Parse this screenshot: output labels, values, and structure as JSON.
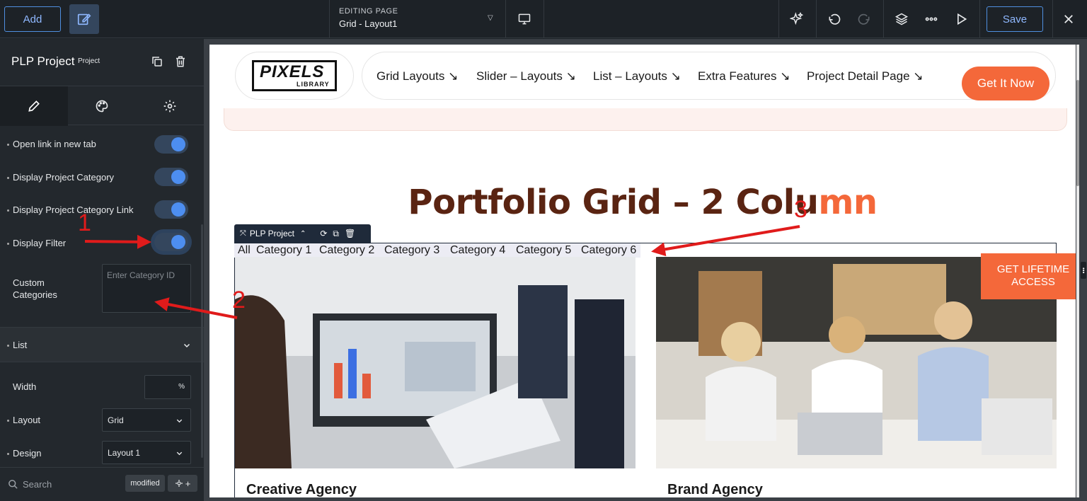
{
  "topbar": {
    "add_label": "Add",
    "editing_label": "EDITING PAGE",
    "page_name": "Grid - Layout1",
    "save_label": "Save"
  },
  "panel": {
    "title": "PLP Project",
    "subtitle": "Project",
    "toggles": [
      {
        "label": "Open link in new tab",
        "on": true
      },
      {
        "label": "Display Project Category",
        "on": true
      },
      {
        "label": "Display Project Category Link",
        "on": true
      },
      {
        "label": "Display Filter",
        "on": true
      }
    ],
    "custom_categories": {
      "label_line1": "Custom",
      "label_line2": "Categories",
      "placeholder": "Enter Category ID"
    },
    "list_section": "List",
    "width": {
      "label": "Width",
      "unit": "%"
    },
    "layout": {
      "label": "Layout",
      "value": "Grid"
    },
    "design": {
      "label": "Design",
      "value": "Layout 1"
    },
    "search_placeholder": "Search",
    "modified_badge": "modified"
  },
  "site": {
    "logo_main": "PIXELS",
    "logo_sub": "LIBRARY",
    "nav": [
      "Grid Layouts ↘",
      "Slider – Layouts ↘",
      "List – Layouts ↘",
      "Extra Features ↘",
      "Project Detail Page ↘"
    ],
    "cta": "Get It Now",
    "heading_main": "Portfolio Grid – 2 Colu",
    "heading_accent": "mn",
    "widget_label": "PLP Project",
    "filters": [
      "All",
      "Category 1",
      "Category 2",
      "Category 3",
      "Category 4",
      "Category 5",
      "Category 6"
    ],
    "cards": [
      "Creative Agency",
      "Brand Agency"
    ],
    "lifetime_line1": "GET LIFETIME",
    "lifetime_line2": "ACCESS"
  },
  "annotations": [
    "1",
    "2",
    "3"
  ],
  "colors": {
    "accent": "#f4683a",
    "heading": "#5a2412",
    "toggle": "#4d8ef0",
    "arrow": "#e01b1b"
  }
}
